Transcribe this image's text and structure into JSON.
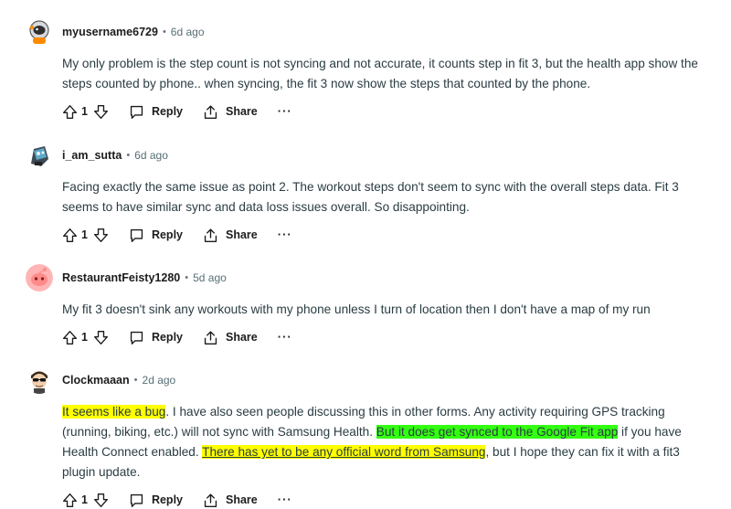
{
  "comments": [
    {
      "username": "myusername6729",
      "separator": "•",
      "time": "6d ago",
      "avatar_icon": "astronaut-avatar-icon",
      "text_parts": [
        {
          "text": "My only problem is the step count is not syncing and not accurate, it counts step in fit 3, but the health app show the steps counted by phone.. when syncing, the fit 3 now show the steps that counted by the phone.",
          "highlight": "none"
        }
      ],
      "vote_count": "1",
      "reply_label": "Reply",
      "share_label": "Share",
      "more_label": "···"
    },
    {
      "username": "i_am_sutta",
      "separator": "•",
      "time": "6d ago",
      "avatar_icon": "robot-avatar-icon",
      "text_parts": [
        {
          "text": "Facing exactly the same issue as point 2. The workout steps don't seem to sync with the overall steps data. Fit 3 seems to have similar sync and data loss issues overall. So disappointing.",
          "highlight": "none"
        }
      ],
      "vote_count": "1",
      "reply_label": "Reply",
      "share_label": "Share",
      "more_label": "···"
    },
    {
      "username": "RestaurantFeisty1280",
      "separator": "•",
      "time": "5d ago",
      "avatar_icon": "default-snoo-avatar-icon",
      "text_parts": [
        {
          "text": "My fit 3 doesn't sink any workouts with my phone unless I turn of location then I don't have a map of my run",
          "highlight": "none"
        }
      ],
      "vote_count": "1",
      "reply_label": "Reply",
      "share_label": "Share",
      "more_label": "···"
    },
    {
      "username": "Clockmaaan",
      "separator": "•",
      "time": "2d ago",
      "avatar_icon": "sunglasses-avatar-icon",
      "text_parts": [
        {
          "text": "It seems like a bug",
          "highlight": "yellow"
        },
        {
          "text": ". I have also seen people discussing this in other forms. Any activity requiring GPS tracking (running, biking, etc.) will not sync with Samsung Health. ",
          "highlight": "none"
        },
        {
          "text": "But it does get synced to the Google Fit app",
          "highlight": "green"
        },
        {
          "text": " if you have Health Connect enabled. ",
          "highlight": "none"
        },
        {
          "text": "There has yet to be any official word from Samsung",
          "highlight": "yellow-underline"
        },
        {
          "text": ", but I hope they can fix it with a fit3 plugin update.",
          "highlight": "none"
        }
      ],
      "vote_count": "1",
      "reply_label": "Reply",
      "share_label": "Share",
      "more_label": "···"
    }
  ],
  "colors": {
    "highlight_yellow": "#ffff00",
    "highlight_green": "#33ff11",
    "text": "#2a3c42",
    "meta": "#576f76"
  }
}
